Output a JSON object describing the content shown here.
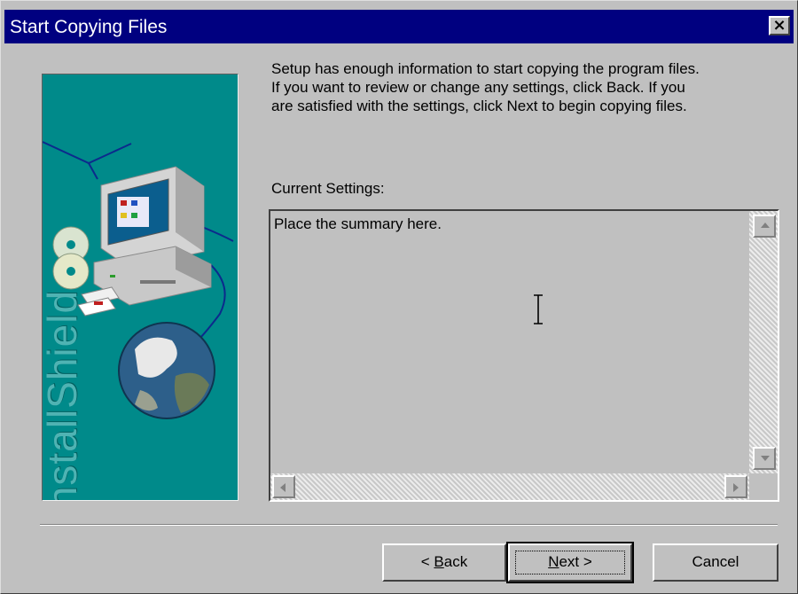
{
  "window": {
    "title": "Start Copying Files",
    "close_symbol": "×"
  },
  "art": {
    "brand_text": "InstallShield"
  },
  "intro_text": "Setup has enough information to start copying the program files.\nIf you want to review or change any settings, click Back.  If you\nare satisfied with the settings, click Next to begin copying files.",
  "settings": {
    "label": "Current Settings:",
    "summary": "Place the summary here."
  },
  "buttons": {
    "back_prefix": "< ",
    "back_access": "B",
    "back_rest": "ack",
    "next_access": "N",
    "next_rest": "ext >",
    "cancel": "Cancel"
  },
  "icons": {
    "close": "close-icon",
    "scroll_up": "scroll-up-arrow-icon",
    "scroll_down": "scroll-down-arrow-icon",
    "scroll_left": "scroll-left-arrow-icon",
    "scroll_right": "scroll-right-arrow-icon",
    "text_cursor": "ibeam-cursor-icon"
  },
  "colors": {
    "titlebar": "#000080",
    "art_background": "#008a8a",
    "dialog_face": "#c0c0c0"
  }
}
